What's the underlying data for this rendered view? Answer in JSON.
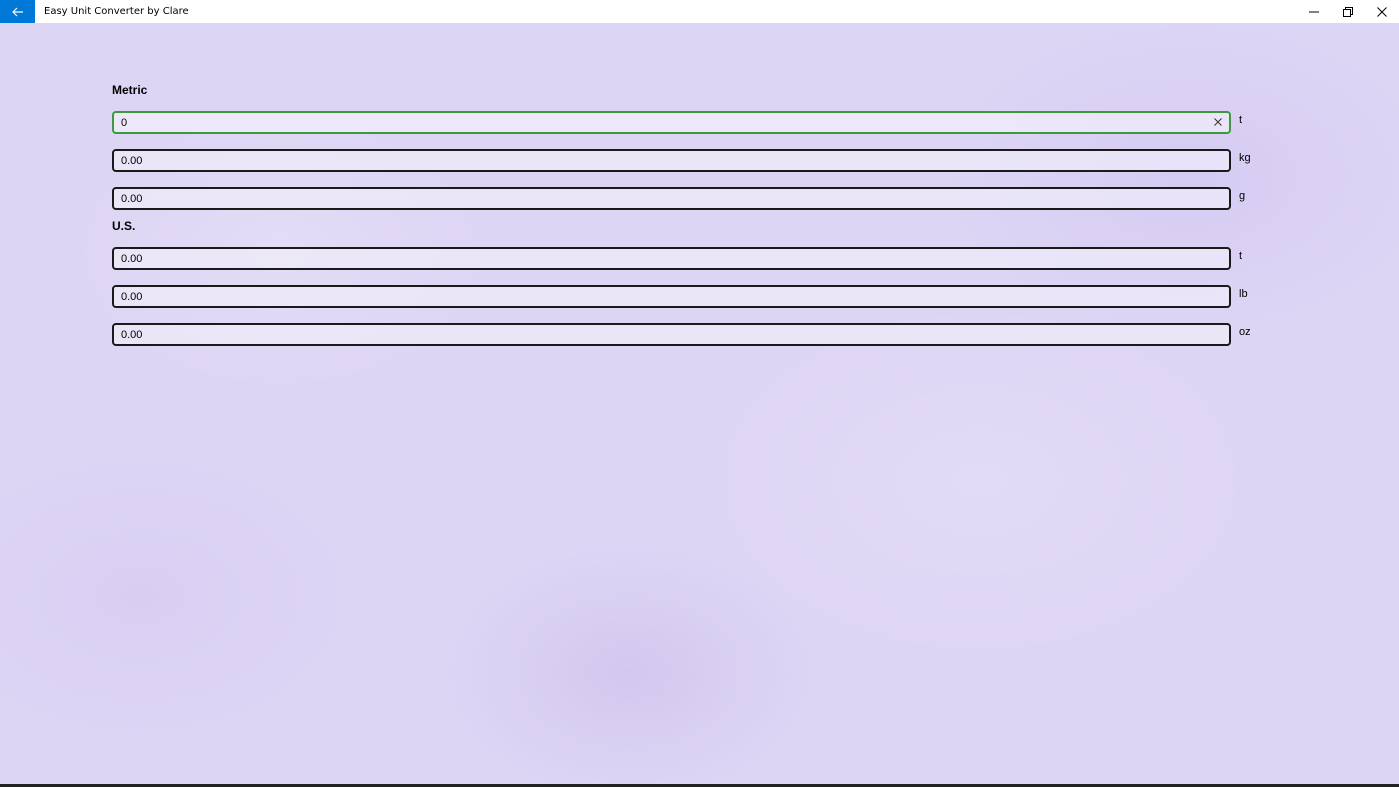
{
  "window": {
    "title": "Easy Unit Converter by Clare",
    "back_icon": "arrow-left-icon",
    "controls": [
      "minimize-icon",
      "restore-icon",
      "close-icon"
    ]
  },
  "metric": {
    "label": "Metric",
    "fields": [
      {
        "value": "0",
        "unit": "t"
      },
      {
        "value": "0.00",
        "unit": "kg"
      },
      {
        "value": "0.00",
        "unit": "g"
      }
    ]
  },
  "us": {
    "label": "U.S.",
    "fields": [
      {
        "value": "0.00",
        "unit": "t"
      },
      {
        "value": "0.00",
        "unit": "lb"
      },
      {
        "value": "0.00",
        "unit": "oz"
      }
    ]
  },
  "colors": {
    "accent": "#0078d7",
    "focus_border": "#3c9a3c",
    "background": "#ddd5f4"
  }
}
